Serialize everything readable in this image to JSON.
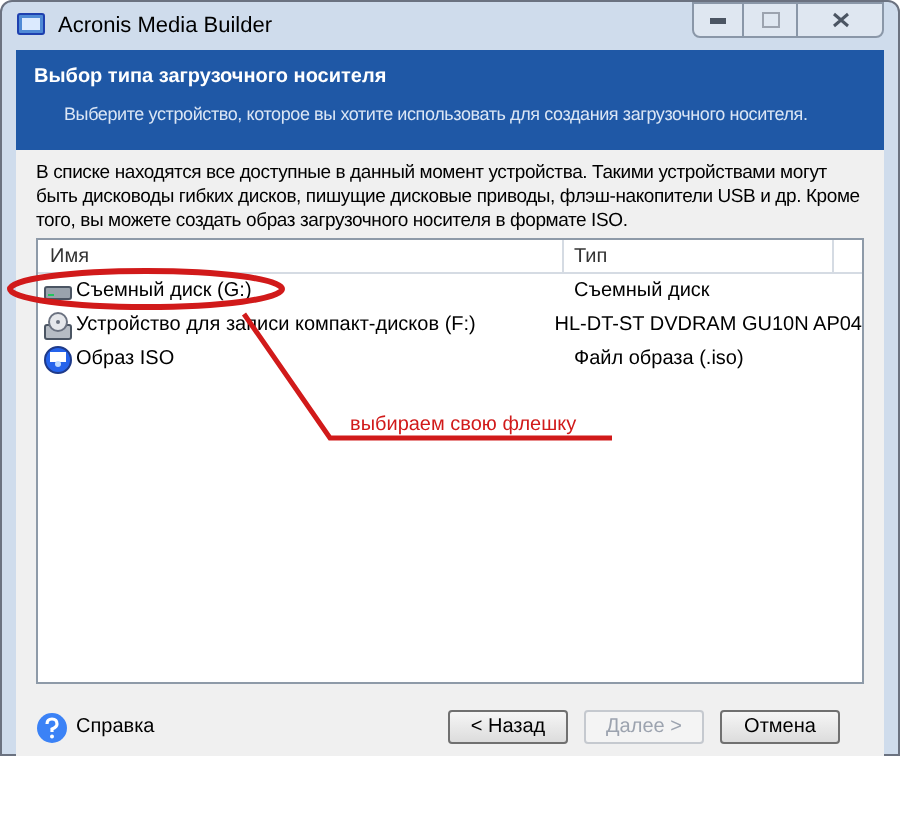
{
  "window": {
    "title": "Acronis Media Builder"
  },
  "header": {
    "title": "Выбор типа загрузочного носителя",
    "subtitle": "Выберите устройство, которое вы хотите использовать для создания загрузочного носителя."
  },
  "description": "В списке находятся все доступные в данный момент устройства. Такими устройствами могут быть дисководы гибких дисков, пишущие дисковые приводы, флэш-накопители USB и др. Кроме того, вы можете создать образ загрузочного носителя в формате ISO.",
  "table": {
    "columns": [
      "Имя",
      "Тип"
    ],
    "rows": [
      {
        "kind": "removable",
        "name": "Съемный диск (G:)",
        "type": "Съемный диск",
        "selected": false
      },
      {
        "kind": "optical",
        "name": "Устройство для записи компакт-дисков (F:)",
        "type": "HL-DT-ST DVDRAM GU10N AP04",
        "selected": false
      },
      {
        "kind": "iso",
        "name": "Образ ISO",
        "type": "Файл образа (.iso)",
        "selected": false
      }
    ]
  },
  "annotation": {
    "text": "выбираем свою флешку"
  },
  "help_link": "Справка",
  "buttons": [
    {
      "label": "< Назад",
      "disabled": false
    },
    {
      "label": "Далее >",
      "disabled": true
    },
    {
      "label": "Отмена",
      "disabled": false
    }
  ]
}
